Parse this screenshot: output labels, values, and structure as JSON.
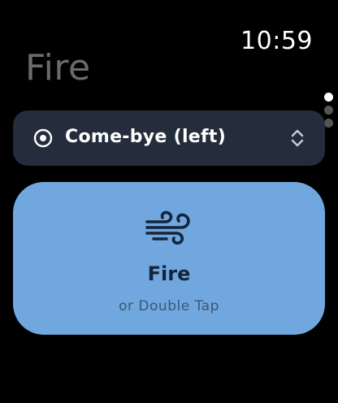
{
  "status_bar": {
    "time": "10:59"
  },
  "header": {
    "title": "Fire"
  },
  "pager": {
    "page_count": 3,
    "active_index": 0
  },
  "command_picker": {
    "icon": "target-icon",
    "label": "Come-bye (left)",
    "trailing_icon": "chevron-up-down-icon"
  },
  "action_button": {
    "icon": "wind-icon",
    "label": "Fire",
    "sublabel": "or Double Tap"
  },
  "colors": {
    "background": "#000000",
    "title_gray": "#6b6b6b",
    "picker_background": "#232d3b",
    "action_background": "#6fa7de",
    "action_text": "#14243a"
  }
}
